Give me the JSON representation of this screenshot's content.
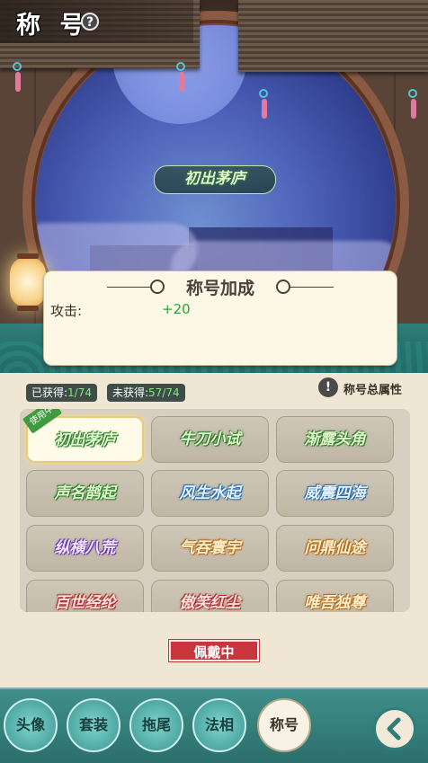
{
  "header": {
    "title": "称 号",
    "help_icon": "?"
  },
  "preview": {
    "equipped_title": "初出茅庐"
  },
  "bonus": {
    "title": "称号加成",
    "stats": [
      {
        "label": "攻击:",
        "value": "+20"
      }
    ]
  },
  "counts": {
    "obtained_label": "已获得:",
    "obtained_value": "1/74",
    "unobtained_label": "未获得:",
    "unobtained_value": "57/74"
  },
  "total_attributes": {
    "icon": "!",
    "label": "称号总属性"
  },
  "titles": [
    {
      "name": "初出茅庐",
      "tint": "green",
      "selected": true,
      "tag": "使用中"
    },
    {
      "name": "牛刀小试",
      "tint": "green"
    },
    {
      "name": "渐露头角",
      "tint": "green"
    },
    {
      "name": "声名鹊起",
      "tint": "green"
    },
    {
      "name": "风生水起",
      "tint": "blue"
    },
    {
      "name": "威震四海",
      "tint": "blue"
    },
    {
      "name": "纵横八荒",
      "tint": "purple"
    },
    {
      "name": "气吞寰宇",
      "tint": "orange"
    },
    {
      "name": "问鼎仙途",
      "tint": "orange"
    },
    {
      "name": "百世经纶",
      "tint": "red"
    },
    {
      "name": "傲笑红尘",
      "tint": "red"
    },
    {
      "name": "唯吾独尊",
      "tint": "orange"
    }
  ],
  "wear_button": "佩戴中",
  "nav": [
    {
      "label": "头像"
    },
    {
      "label": "套装"
    },
    {
      "label": "拖尾"
    },
    {
      "label": "法相"
    },
    {
      "label": "称号",
      "active": true
    }
  ],
  "colors": {
    "accent": "#2c6f6c",
    "equipped": "#c8363b",
    "stat_green": "#2fa32f"
  }
}
